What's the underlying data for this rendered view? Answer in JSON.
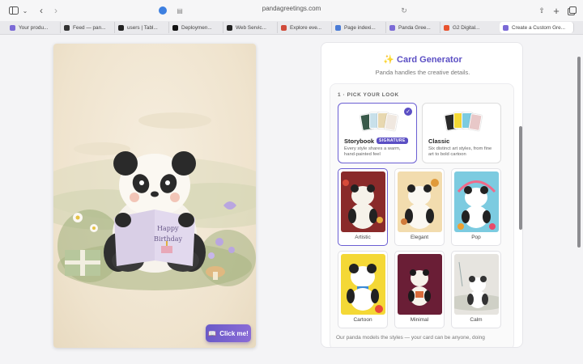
{
  "browser": {
    "url": "pandagreetings.com",
    "tabs": [
      {
        "label": "Your produ...",
        "color": "#7b6ad6"
      },
      {
        "label": "Feed — pan...",
        "color": "#333333"
      },
      {
        "label": "users | Tabl...",
        "color": "#222222"
      },
      {
        "label": "Deploymen...",
        "color": "#111111"
      },
      {
        "label": "Web Servic...",
        "color": "#222222"
      },
      {
        "label": "Explore eve...",
        "color": "#d04a3a"
      },
      {
        "label": "Page indexi...",
        "color": "#4a7bd6"
      },
      {
        "label": "Panda Gree...",
        "color": "#7b6ad6"
      },
      {
        "label": "G2 Digital...",
        "color": "#e8532f"
      },
      {
        "label": "Create a Custom Gre...",
        "color": "#7b6ad6"
      }
    ]
  },
  "preview": {
    "book_text_1": "Happy",
    "book_text_2": "Birthday",
    "button_label": "Click me!"
  },
  "generator": {
    "title": "Card Generator",
    "subtitle": "Panda handles the creative details.",
    "step_label": "1 · PICK YOUR LOOK",
    "styles": [
      {
        "name": "Storybook",
        "badge": "SIGNATURE",
        "desc": "Every style shares a warm, hand-painted feel",
        "selected": true
      },
      {
        "name": "Classic",
        "badge": "",
        "desc": "Six distinct art styles, from fine art to bold cartoon",
        "selected": false
      }
    ],
    "art_styles": [
      {
        "label": "Artistic",
        "bg": "#8a2a2a",
        "selected": true
      },
      {
        "label": "Elegant",
        "bg": "#f2dcae",
        "selected": false
      },
      {
        "label": "Pop",
        "bg": "#7ccbe0",
        "selected": false
      },
      {
        "label": "Cartoon",
        "bg": "#f4d836",
        "selected": false
      },
      {
        "label": "Minimal",
        "bg": "#6a1e36",
        "selected": false
      },
      {
        "label": "Calm",
        "bg": "#e6e4df",
        "selected": false
      }
    ],
    "footer": "Our panda models the styles — your card can be anyone, doing"
  },
  "colors": {
    "accent": "#5b4fc4"
  }
}
